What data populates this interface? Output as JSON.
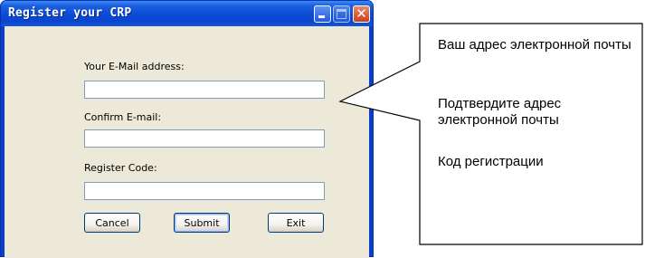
{
  "window": {
    "title": "Register your CRP",
    "controls": {
      "minimize_icon": "minimize-icon",
      "maximize_icon": "maximize-icon",
      "close_icon": "close-icon",
      "close_glyph": "✕"
    }
  },
  "form": {
    "email_label": "Your E-Mail address:",
    "email_value": "",
    "confirm_label": "Confirm E-mail:",
    "confirm_value": "",
    "code_label": "Register Code:",
    "code_value": ""
  },
  "buttons": {
    "cancel": "Cancel",
    "submit": "Submit",
    "exit": "Exit"
  },
  "callout": {
    "items": [
      "Ваш адрес электронной почты",
      "Подтвердите адрес электронной почты",
      "Код регистрации"
    ]
  },
  "colors": {
    "titlebar": "#0a4bd6",
    "client": "#ece9d8",
    "close_button": "#c8421f"
  }
}
